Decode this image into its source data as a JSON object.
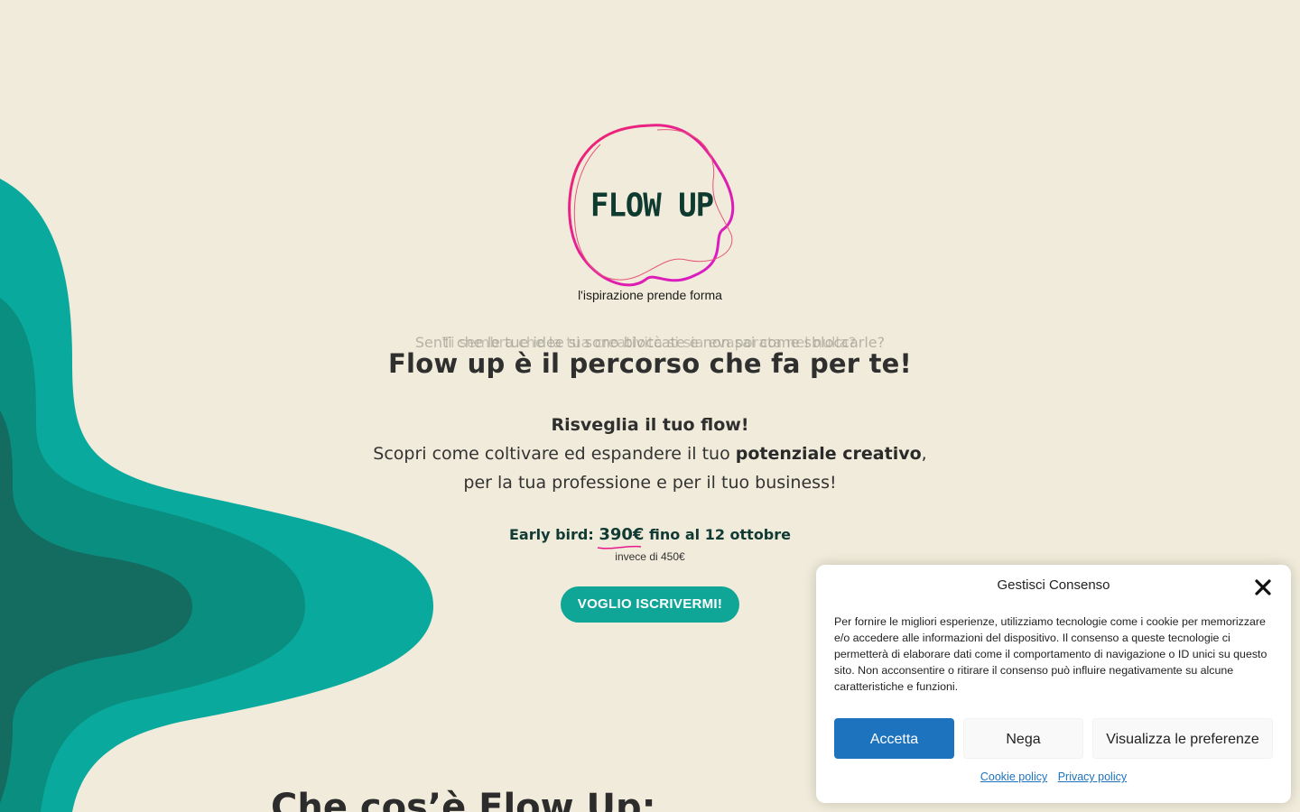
{
  "logo": {
    "name": "FLOW UP",
    "tagline": "l'ispirazione prende forma"
  },
  "hero": {
    "rotating_text_a": "Senti che le tue idee si sono bloccate e non sai come sbloccarle?",
    "rotating_text_b": "Ti sembra che la tua creatività si sia evaporata nel nulla?",
    "headline": "Flow up è il percorso che fa per te!",
    "sub_strong": "Risveglia il tuo flow!",
    "sub_line1_pre": "Scopri come coltivare ed espandere il tuo ",
    "sub_line1_bold": "potenziale creativo",
    "sub_line1_post": ",",
    "sub_line2": "per la tua professione e per il tuo business!",
    "earlybird_label": "Early bird: ",
    "earlybird_price": "390€",
    "earlybird_deadline": " fino al 12 ottobre",
    "instead": "invece di 450€",
    "cta": "VOGLIO ISCRIVERMI!"
  },
  "section": {
    "title": "Che cos’è Flow Up:"
  },
  "consent": {
    "title": "Gestisci Consenso",
    "body": "Per fornire le migliori esperienze, utilizziamo tecnologie come i cookie per memorizzare e/o accedere alle informazioni del dispositivo. Il consenso a queste tecnologie ci permetterà di elaborare dati come il comportamento di navigazione o ID unici su questo sito. Non acconsentire o ritirare il consenso può influire negativamente su alcune caratteristiche e funzioni.",
    "accept": "Accetta",
    "deny": "Nega",
    "preferences": "Visualizza le preferenze",
    "cookie_policy": "Cookie policy",
    "privacy_policy": "Privacy policy"
  },
  "colors": {
    "background": "#f0ebda",
    "teal_light": "#0aa99d",
    "teal_mid": "#0a8e80",
    "teal_dark": "#146b60",
    "teal_darkest": "#155c53",
    "accent_pink": "#e8198b",
    "button_blue": "#1e73be"
  }
}
